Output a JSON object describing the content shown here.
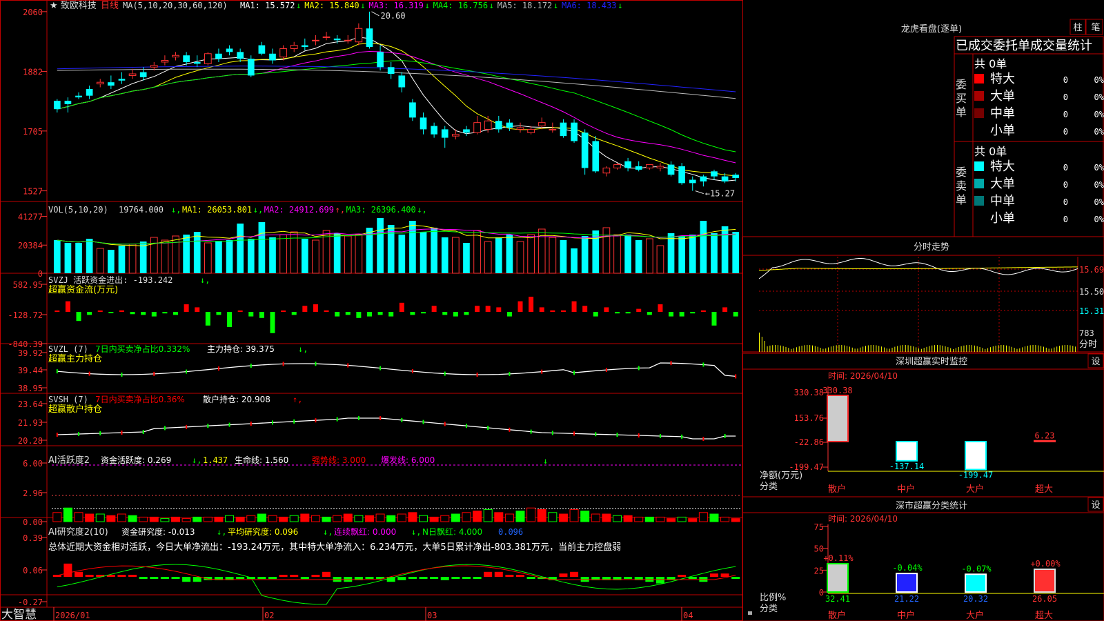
{
  "stock": {
    "title": "★ 致欧科技",
    "period": "日线"
  },
  "ma_header": {
    "prefix": "MA(5,10,20,30,60,120)",
    "items": [
      {
        "label": "MA1: 15.572",
        "arrow": "↓",
        "color": "#ffffff"
      },
      {
        "label": "MA2: 15.840",
        "arrow": "↓",
        "color": "#ffff00"
      },
      {
        "label": "MA3: 16.319",
        "arrow": "↓",
        "color": "#ff00ff"
      },
      {
        "label": "MA4: 16.756",
        "arrow": "↓",
        "color": "#00ff00"
      },
      {
        "label": "MA5: 18.172",
        "arrow": "↓",
        "color": "#bbbbbb"
      },
      {
        "label": "MA6: 18.433",
        "arrow": "↓",
        "color": "#2222ff"
      }
    ]
  },
  "price_axis": {
    "ticks": [
      "2060",
      "1882",
      "1705",
      "1527"
    ],
    "high_label": "20.60",
    "low_label": "15.27"
  },
  "vol": {
    "header": "VOL(5,10,20)",
    "value": "19764.000",
    "arrow": "↓",
    "ma": [
      {
        "label": "MA1: 26053.801",
        "arrow": "↓",
        "color": "#ffff00"
      },
      {
        "label": "MA2: 24912.699",
        "arrow": "↑",
        "color": "#ff00ff"
      },
      {
        "label": "MA3: 26396.400",
        "arrow": "↓",
        "color": "#00ff00"
      }
    ],
    "ticks": [
      "41277",
      "20384",
      "0"
    ]
  },
  "svzj": {
    "header": "SVZJ  活跃资金进出: -193.242",
    "arrow": "↓",
    "sub": "超赢资金流(万元)",
    "ticks": [
      "582.95",
      "-128.72",
      "-840.39"
    ]
  },
  "svzl": {
    "header": "SVZL (7)",
    "part1": "7日内买卖净占比0.332%",
    "part2": "主力持仓: 39.375",
    "arrow": "↓",
    "sub": "超赢主力持仓",
    "ticks": [
      "39.92",
      "39.44",
      "38.95"
    ]
  },
  "svsh": {
    "header": "SVSH (7)",
    "part1": "7日内买卖净占比0.36%",
    "part2": "散户持仓: 20.908",
    "arrow": "↑",
    "sub": "超赢散户持仓",
    "ticks": [
      "23.64",
      "21.93",
      "20.28"
    ]
  },
  "ai_act": {
    "header": "AI活跃度2",
    "p1": "资金活跃度: 0.269",
    "p2": "1.437",
    "p3": "生命线: 1.560",
    "p4": "强势线: 3.000",
    "p5": "爆发线: 6.000",
    "ticks": [
      "6.00",
      "2.96",
      "0.00"
    ]
  },
  "ai_res": {
    "header": "AI研究度2(10)",
    "p1": "资金研究度: -0.013",
    "p2": "平均研究度: 0.096",
    "p3": "连续飘红: 0.000",
    "p4": "N日飘红: 4.000",
    "p5": "0.096",
    "summary": "总体近期大资金相对活跃，今日大单净流出：-193.24万元，其中特大单净流入：6.234万元，大单5日累计净出-803.381万元，当前主力控盘弱",
    "ticks": [
      "0.39",
      "0.06",
      "-0.27"
    ]
  },
  "date_axis": {
    "brand": "大智慧",
    "dates": [
      "2026/01",
      "02",
      "03",
      "04"
    ]
  },
  "right": {
    "dragon": {
      "title": "龙虎看盘(逐单)",
      "btn1": "柱",
      "btn2": "笔",
      "stats_title": "已成交委托单成交量统计",
      "buy": {
        "label": "委买单",
        "total": "共 0单",
        "rows": [
          {
            "name": "特大",
            "n": "0",
            "p": "0%",
            "color": "#ff0000"
          },
          {
            "name": "大单",
            "n": "0",
            "p": "0%",
            "color": "#aa0000"
          },
          {
            "name": "中单",
            "n": "0",
            "p": "0%",
            "color": "#770000"
          },
          {
            "name": "小单",
            "n": "0",
            "p": "0%",
            "color": "#000000"
          }
        ]
      },
      "sell": {
        "label": "委卖单",
        "total": "共 0单",
        "rows": [
          {
            "name": "特大",
            "n": "0",
            "p": "0%",
            "color": "#00ffff"
          },
          {
            "name": "大单",
            "n": "0",
            "p": "0%",
            "color": "#00aaaa"
          },
          {
            "name": "中单",
            "n": "0",
            "p": "0%",
            "color": "#007777"
          },
          {
            "name": "小单",
            "n": "0",
            "p": "0%",
            "color": "#000000"
          }
        ]
      }
    },
    "intraday": {
      "title": "分时走势",
      "ticks": [
        "15.69",
        "15.50",
        "15.31"
      ],
      "vol_tick": "783",
      "vol_label": "分时"
    },
    "monitor": {
      "title": "深圳超赢实时监控",
      "btn": "设",
      "time": "时间: 2026/04/10",
      "ticks": [
        "330.38",
        "153.76",
        "-22.86",
        "-199.47"
      ],
      "ylabel": "净额(万元)",
      "xlabel": "分类",
      "cats": [
        "散户",
        "中户",
        "大户",
        "超大"
      ],
      "values": [
        "330.38",
        "-137.14",
        "-199.47",
        "6.23"
      ]
    },
    "classify": {
      "title": "深市超赢分类统计",
      "btn": "设",
      "time": "时间: 2026/04/10",
      "ticks": [
        "75",
        "50",
        "25",
        "0"
      ],
      "ylabel": "比例%",
      "xlabel": "分类",
      "cats": [
        "散户",
        "中户",
        "大户",
        "超大"
      ],
      "values": [
        "32.41",
        "21.22",
        "20.32",
        "26.05"
      ],
      "changes": [
        "+0.11%",
        "-0.04%",
        "-0.07%",
        "+0.00%"
      ]
    }
  },
  "chart_data": {
    "type": "candlestick",
    "title": "致欧科技 日线",
    "ylim": [
      15.27,
      20.6
    ],
    "open": [
      17.95,
      17.95,
      18.1,
      18.3,
      18.45,
      18.5,
      18.6,
      18.7,
      18.8,
      18.95,
      19.1,
      19.25,
      19.3,
      19.1,
      19.05,
      19.35,
      19.5,
      19.4,
      19.2,
      19.6,
      19.35,
      19.25,
      19.5,
      19.6,
      19.75,
      19.85,
      19.8,
      19.75,
      19.7,
      20.1,
      19.4,
      18.95,
      18.7,
      17.9,
      17.45,
      17.2,
      17.1,
      16.9,
      17.1,
      17.0,
      17.1,
      17.35,
      17.3,
      17.1,
      17.0,
      17.2,
      17.1,
      17.3,
      17.3,
      17.0,
      16.75,
      15.8,
      15.95,
      16.15,
      16.0,
      15.95,
      15.95,
      16.05,
      16.0,
      15.6,
      15.7,
      15.85,
      15.7,
      15.75
    ],
    "close": [
      17.7,
      17.85,
      18.05,
      18.1,
      18.5,
      18.4,
      18.55,
      18.75,
      18.65,
      19.0,
      19.15,
      19.3,
      19.1,
      19.05,
      19.35,
      19.2,
      19.4,
      19.2,
      18.7,
      19.35,
      19.15,
      19.5,
      19.6,
      19.55,
      19.75,
      19.85,
      19.75,
      19.75,
      20.1,
      19.55,
      18.95,
      18.75,
      18.35,
      17.45,
      17.1,
      16.95,
      16.85,
      16.95,
      17.0,
      17.3,
      17.35,
      17.1,
      17.15,
      17.15,
      17.1,
      17.3,
      17.1,
      16.9,
      16.75,
      15.95,
      15.85,
      15.95,
      16.05,
      15.95,
      15.9,
      16.05,
      16.0,
      15.75,
      15.5,
      15.5,
      15.55,
      15.7,
      15.55,
      15.65
    ],
    "high": [
      18.0,
      18.05,
      18.2,
      18.4,
      18.6,
      18.7,
      18.8,
      18.9,
      18.95,
      19.1,
      19.3,
      19.4,
      19.4,
      19.3,
      19.4,
      19.5,
      19.6,
      19.5,
      19.3,
      19.7,
      19.5,
      19.6,
      19.7,
      19.8,
      19.9,
      20.0,
      19.9,
      19.9,
      20.25,
      20.6,
      19.6,
      19.1,
      18.8,
      18.0,
      17.6,
      17.3,
      17.2,
      17.1,
      17.2,
      17.5,
      17.5,
      17.5,
      17.4,
      17.3,
      17.2,
      17.45,
      17.3,
      17.4,
      17.4,
      17.1,
      16.9,
      16.0,
      16.1,
      16.25,
      16.15,
      16.05,
      16.1,
      16.15,
      16.1,
      15.7,
      15.75,
      15.9,
      15.8,
      15.8
    ],
    "low": [
      17.6,
      17.6,
      18.0,
      18.0,
      18.35,
      18.3,
      18.45,
      18.6,
      18.55,
      18.85,
      19.0,
      19.15,
      19.0,
      18.95,
      19.0,
      19.1,
      19.3,
      19.1,
      18.65,
      19.3,
      19.05,
      19.15,
      19.4,
      19.45,
      19.6,
      19.75,
      19.65,
      19.65,
      19.6,
      19.5,
      18.85,
      18.6,
      18.2,
      17.35,
      16.95,
      16.85,
      16.55,
      16.8,
      16.9,
      16.95,
      17.0,
      17.0,
      17.05,
      17.0,
      16.95,
      17.1,
      17.0,
      16.85,
      16.7,
      15.75,
      15.8,
      15.7,
      15.9,
      15.85,
      15.85,
      15.9,
      15.85,
      15.7,
      15.45,
      15.27,
      15.4,
      15.6,
      15.5,
      15.55
    ],
    "volume": [
      24,
      22,
      22,
      25,
      18,
      17,
      20,
      21,
      23,
      26,
      24,
      27,
      28,
      30,
      22,
      23,
      24,
      36,
      25,
      37,
      26,
      28,
      30,
      25,
      24,
      31,
      29,
      27,
      28,
      33,
      40,
      35,
      28,
      38,
      30,
      33,
      26,
      26,
      22,
      31,
      23,
      26,
      28,
      23,
      28,
      32,
      26,
      24,
      18,
      27,
      31,
      33,
      28,
      28,
      24,
      25,
      20,
      29,
      27,
      28,
      38,
      29,
      34,
      30
    ]
  }
}
